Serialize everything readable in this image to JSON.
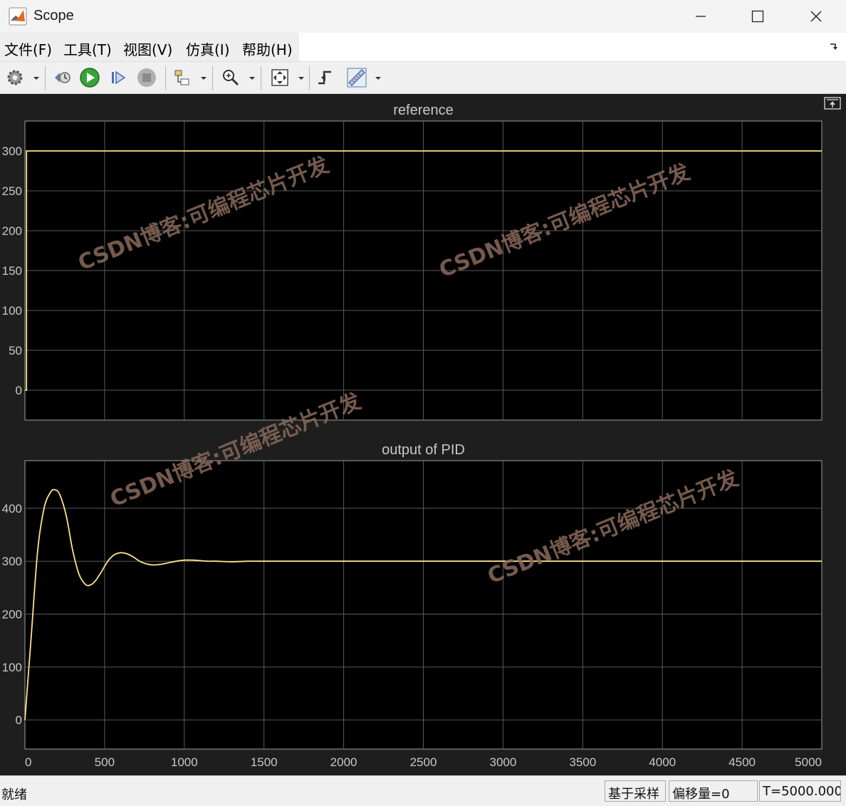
{
  "window": {
    "title": "Scope",
    "app_icon": "matlab-icon"
  },
  "menu": {
    "items": [
      "文件(F)",
      "工具(T)",
      "视图(V)",
      "仿真(I)",
      "帮助(H)"
    ]
  },
  "toolbar": {
    "icons": [
      "settings-gear-icon",
      "step-back-icon",
      "run-icon",
      "step-forward-icon",
      "stop-icon",
      "highlight-block-icon",
      "zoom-icon",
      "autoscale-icon",
      "triggers-icon",
      "measurements-ruler-icon"
    ]
  },
  "watermark": "CSDN博客:可编程芯片开发",
  "status": {
    "ready": "就绪",
    "sample_based": "基于采样",
    "offset": "偏移量=0",
    "time": "T=5000.000"
  },
  "colors": {
    "plot_bg": "#000000",
    "figure_bg": "#1e1e1e",
    "grid": "#5a5a5a",
    "trace": "#ffe28a",
    "axis_text": "#c8c8c8",
    "watermark": "#8a6a5a"
  },
  "chart_data": [
    {
      "type": "line",
      "title": "reference",
      "xlim": [
        0,
        5000
      ],
      "ylim": [
        -37.5,
        337.5
      ],
      "yticks": [
        0,
        50,
        100,
        150,
        200,
        250,
        300
      ],
      "xticks": [
        0,
        500,
        1000,
        1500,
        2000,
        2500,
        3000,
        3500,
        4000,
        4500,
        5000
      ],
      "grid": true,
      "series": [
        {
          "x": [
            0,
            10,
            10,
            5000
          ],
          "y": [
            0,
            0,
            300,
            300
          ]
        }
      ]
    },
    {
      "type": "line",
      "title": "output of PID",
      "xlim": [
        0,
        5000
      ],
      "ylim": [
        -55,
        490
      ],
      "yticks": [
        0,
        100,
        200,
        300,
        400
      ],
      "xticks": [
        0,
        500,
        1000,
        1500,
        2000,
        2500,
        3000,
        3500,
        4000,
        4500,
        5000
      ],
      "xticklabels": [
        "0",
        "500",
        "1000",
        "1500",
        "2000",
        "2500",
        "3000",
        "3500",
        "4000",
        "4500",
        "5000"
      ],
      "grid": true,
      "series": [
        {
          "x": [
            0,
            40,
            80,
            120,
            160,
            190,
            220,
            260,
            300,
            340,
            380,
            410,
            440,
            480,
            520,
            560,
            600,
            640,
            680,
            720,
            760,
            800,
            850,
            900,
            950,
            1000,
            1050,
            1100,
            1150,
            1200,
            1300,
            1400,
            1500,
            1600,
            1800,
            2000,
            2500,
            3000,
            4000,
            5000
          ],
          "y": [
            0,
            160,
            320,
            400,
            430,
            435,
            425,
            385,
            320,
            275,
            256,
            255,
            262,
            280,
            300,
            312,
            316,
            314,
            308,
            300,
            295,
            293,
            294,
            297,
            300,
            302,
            302,
            301,
            300,
            300,
            299,
            300,
            300,
            300,
            300,
            300,
            300,
            300,
            300,
            300
          ]
        }
      ]
    }
  ]
}
